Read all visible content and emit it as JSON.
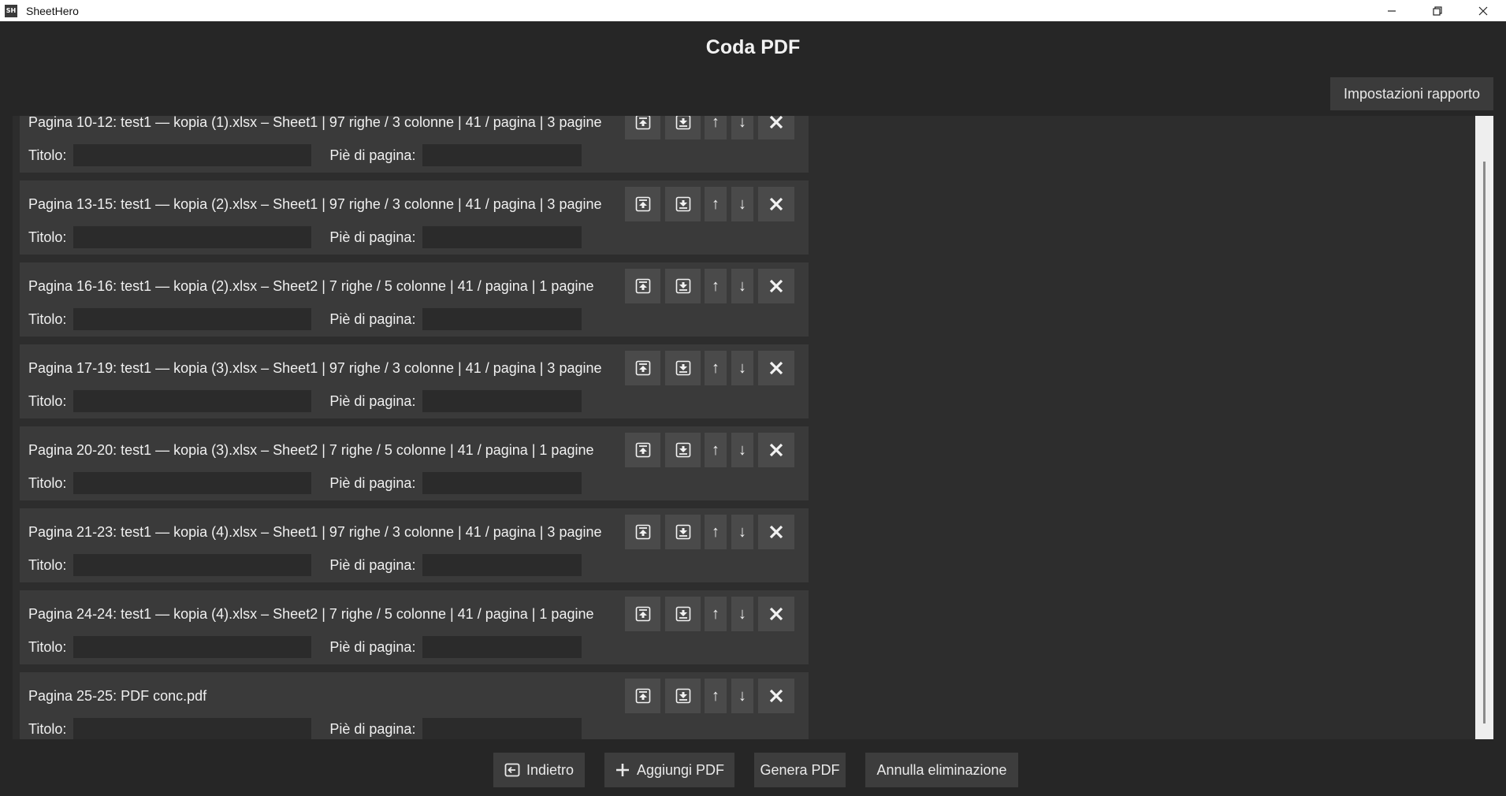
{
  "window": {
    "app_icon_text": "SH",
    "title": "SheetHero",
    "minimize_icon": "minimize-icon",
    "maximize_icon": "restore-icon",
    "close_icon": "close-icon"
  },
  "page": {
    "heading": "Coda PDF",
    "settings_button": "Impostazioni rapporto"
  },
  "field_labels": {
    "title": "Titolo:",
    "footer": "Piè di pagina:"
  },
  "item_buttons": {
    "move_top_icon": "move-to-top-icon",
    "move_bottom_icon": "move-to-bottom-icon",
    "up": "↑",
    "down": "↓",
    "remove_icon": "close-icon"
  },
  "queue_items": [
    {
      "label": "Pagina 10-12: test1 — kopia (1).xlsx – Sheet1 | 97 righe / 3 colonne | 41 / pagina | 3 pagine",
      "title_value": "",
      "footer_value": ""
    },
    {
      "label": "Pagina 13-15: test1 — kopia (2).xlsx – Sheet1 | 97 righe / 3 colonne | 41 / pagina | 3 pagine",
      "title_value": "",
      "footer_value": ""
    },
    {
      "label": "Pagina 16-16: test1 — kopia (2).xlsx – Sheet2 | 7 righe / 5 colonne | 41 / pagina | 1 pagine",
      "title_value": "",
      "footer_value": ""
    },
    {
      "label": "Pagina 17-19: test1 — kopia (3).xlsx – Sheet1 | 97 righe / 3 colonne | 41 / pagina | 3 pagine",
      "title_value": "",
      "footer_value": ""
    },
    {
      "label": "Pagina 20-20: test1 — kopia (3).xlsx – Sheet2 | 7 righe / 5 colonne | 41 / pagina | 1 pagine",
      "title_value": "",
      "footer_value": ""
    },
    {
      "label": "Pagina 21-23: test1 — kopia (4).xlsx – Sheet1 | 97 righe / 3 colonne | 41 / pagina | 3 pagine",
      "title_value": "",
      "footer_value": ""
    },
    {
      "label": "Pagina 24-24: test1 — kopia (4).xlsx – Sheet2 | 7 righe / 5 colonne | 41 / pagina | 1 pagine",
      "title_value": "",
      "footer_value": ""
    },
    {
      "label": "Pagina 25-25: PDF conc.pdf",
      "title_value": "",
      "footer_value": ""
    }
  ],
  "bottom_buttons": {
    "back": "Indietro",
    "back_icon": "back-arrow-icon",
    "add_pdf": "Aggiungi PDF",
    "add_icon": "plus-icon",
    "generate_pdf": "Genera PDF",
    "undo_delete": "Annulla eliminazione"
  }
}
